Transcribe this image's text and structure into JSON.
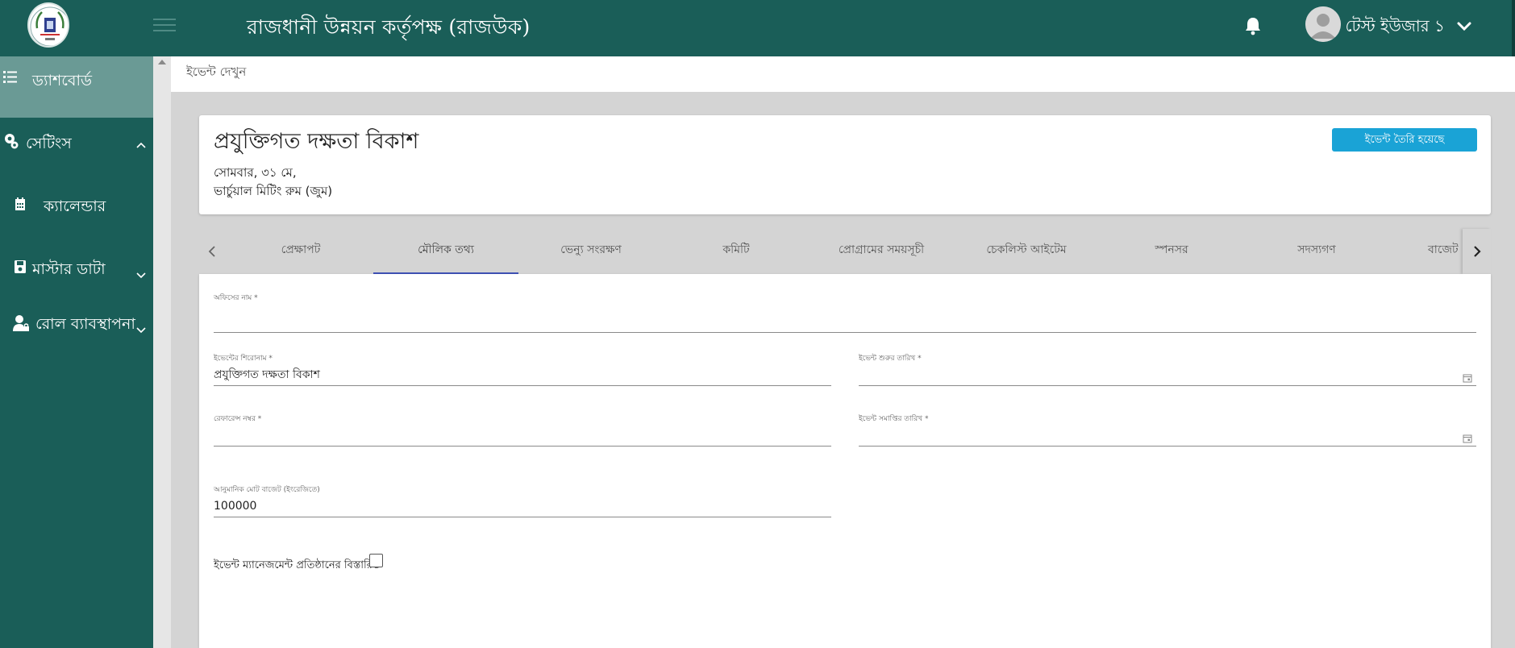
{
  "header": {
    "app_title": "রাজধানী উন্নয়ন কর্তৃপক্ষ (রাজউক)",
    "user_name": "টেস্ট ইউজার ১"
  },
  "sidebar": {
    "items": [
      {
        "label": "ড্যাশবোর্ড",
        "icon": "list-icon",
        "active": true
      },
      {
        "label": "সেটিংস",
        "icon": "gears-icon",
        "chevron": "up"
      },
      {
        "label": "ক্যালেন্ডার",
        "icon": "calendar-icon"
      },
      {
        "label": "মাস্টার ডাটা",
        "icon": "save-icon",
        "chevron": "down"
      },
      {
        "label": "রোল ব্যাবস্থাপনা",
        "icon": "user-lock-icon",
        "chevron": "down"
      }
    ]
  },
  "breadcrumb": "ইভেন্ট দেখুন",
  "event": {
    "title": "প্রযুক্তিগত দক্ষতা বিকাশ",
    "date": "সোমবার, ৩১ মে,",
    "venue": "ভার্চুয়াল মিটিং রুম (জুম)",
    "status_button": "ইভেন্ট তৈরি হয়েছে"
  },
  "tabs": [
    {
      "label": "প্রেক্ষাপট"
    },
    {
      "label": "মৌলিক তথ্য",
      "active": true
    },
    {
      "label": "ভেন্যু সংরক্ষণ"
    },
    {
      "label": "কমিটি"
    },
    {
      "label": "প্রোগ্রামের সময়সূচী"
    },
    {
      "label": "চেকলিস্ট আইটেম"
    },
    {
      "label": "স্পনসর"
    },
    {
      "label": "সদস্যগণ"
    },
    {
      "label": "বাজেট"
    }
  ],
  "form": {
    "office_name": {
      "label": "অফিসের নাম *",
      "value": ""
    },
    "event_title": {
      "label": "ইভেন্টের শিরোনাম *",
      "value": "প্রযুক্তিগত দক্ষতা বিকাশ"
    },
    "start_date": {
      "label": "ইভেন্ট শুরুর তারিখ *",
      "value": ""
    },
    "reference_no": {
      "label": "রেফারেন্স নম্বর *",
      "value": ""
    },
    "end_date": {
      "label": "ইভেন্ট সমাপ্তির তারিখ *",
      "value": ""
    },
    "budget": {
      "label": "আনুমানিক মোট বাজেট (ইংরেজিতে)",
      "value": "100000"
    },
    "management_checkbox": {
      "label": "ইভেন্ট ম্যানেজমেন্ট প্রতিষ্ঠানের বিস্তারিত",
      "checked": false
    }
  },
  "colors": {
    "primary": "#1a5e58",
    "active_sidebar": "#6a9a95",
    "status_button": "#1aa3d6",
    "tab_indicator": "#3f51b5"
  }
}
